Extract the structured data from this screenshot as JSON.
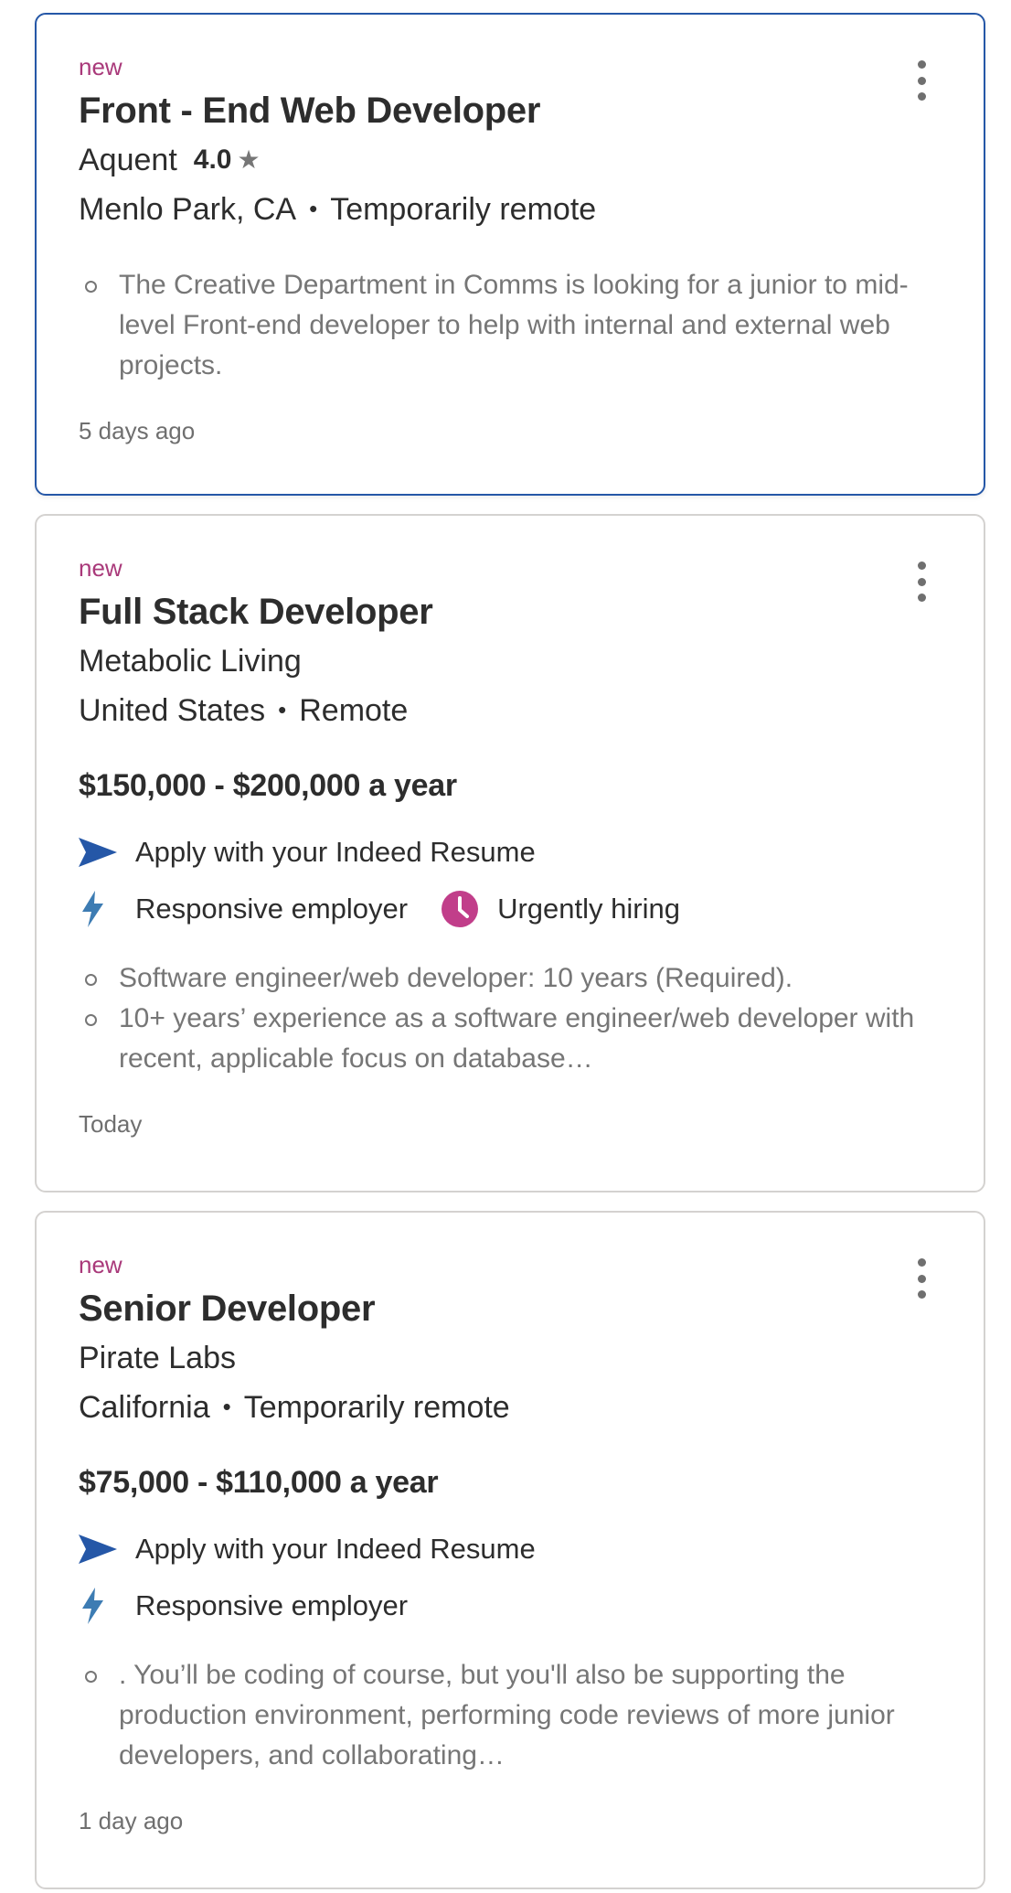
{
  "jobs": [
    {
      "new_label": "new",
      "title": "Front - End Web Developer",
      "company": "Aquent",
      "rating": "4.0",
      "location": "Menlo Park, CA",
      "work_mode": "Temporarily remote",
      "snippet": [
        "The Creative Department in Comms is looking for a junior to mid-level Front-end developer to help with internal and external web projects."
      ],
      "posted": "5 days ago"
    },
    {
      "new_label": "new",
      "title": "Full Stack Developer",
      "company": "Metabolic Living",
      "location": "United States",
      "work_mode": "Remote",
      "salary": "$150,000 - $200,000 a year",
      "features": {
        "apply": "Apply with your Indeed Resume",
        "responsive": "Responsive employer",
        "urgent": "Urgently hiring"
      },
      "snippet": [
        "Software engineer/web developer: 10 years (Required).",
        "10+ years’ experience as a software engineer/web developer with recent, applicable focus on database…"
      ],
      "posted": "Today"
    },
    {
      "new_label": "new",
      "title": "Senior Developer",
      "company": "Pirate Labs",
      "location": "California",
      "work_mode": "Temporarily remote",
      "salary": "$75,000 - $110,000 a year",
      "features": {
        "apply": "Apply with your Indeed Resume",
        "responsive": "Responsive employer"
      },
      "snippet": [
        ". You’ll be coding of course, but you'll also be supporting the production environment, performing code reviews of more junior developers, and collaborating…"
      ],
      "posted": "1 day ago"
    }
  ],
  "icons": {
    "apply": "paper-plane-icon",
    "responsive": "lightning-bolt-icon",
    "urgent": "clock-icon",
    "menu": "more-vertical-icon",
    "rating": "star-icon"
  },
  "colors": {
    "new_tag": "#a9397a",
    "selected_border": "#2557a7",
    "apply_icon": "#2557a7",
    "bolt_icon": "#3d7cb3",
    "urgent_icon": "#c13e8a"
  }
}
